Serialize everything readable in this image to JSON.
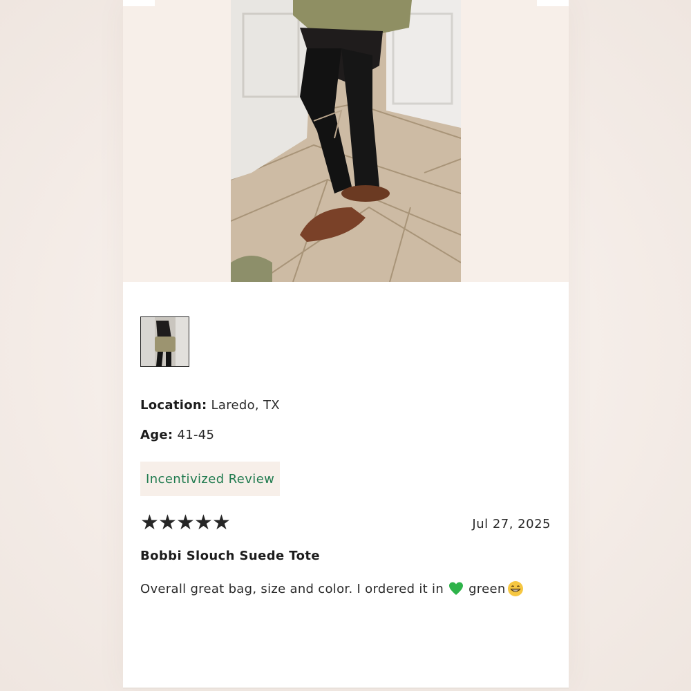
{
  "review": {
    "location_label": "Location:",
    "location_value": "Laredo, TX",
    "age_label": "Age:",
    "age_value": "41-45",
    "badge": "Incentivized Review",
    "rating": 5,
    "stars": [
      "★",
      "★",
      "★",
      "★",
      "★"
    ],
    "date": "Jul 27, 2025",
    "title": "Bobbi Slouch Suede Tote",
    "body_before": "Overall great bag, size and color. I ordered it in",
    "body_middle": "green",
    "emoji_1": "green-heart-icon",
    "emoji_2": "grinning-face-icon"
  },
  "colors": {
    "badge_text": "#1f7a4e",
    "badge_bg": "#f7efe9",
    "stars": "#262626"
  }
}
